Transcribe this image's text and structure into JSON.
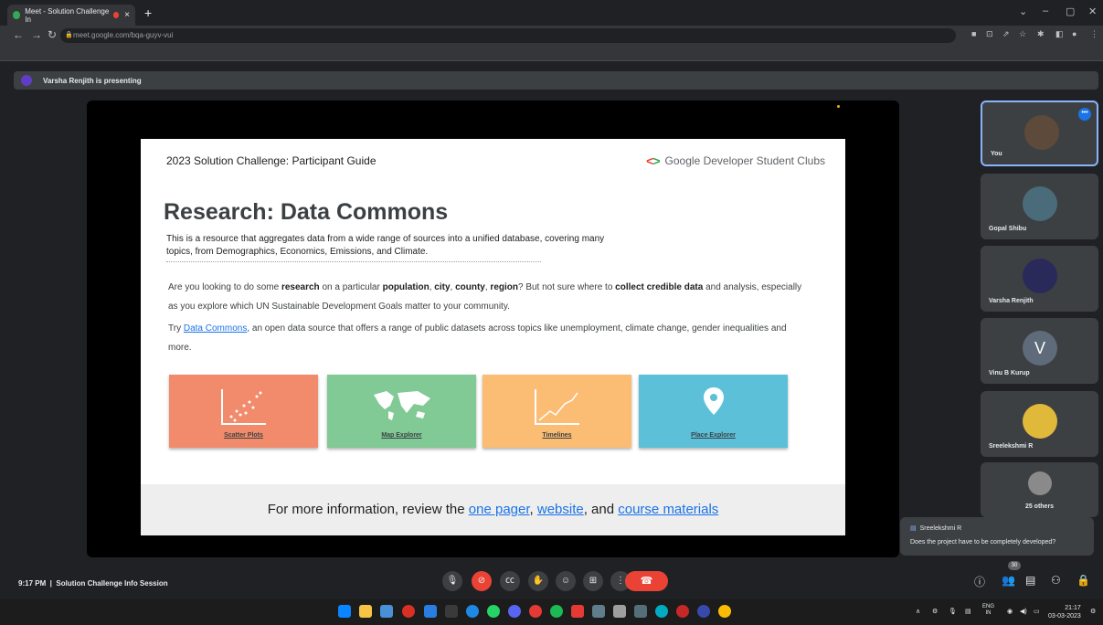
{
  "browser": {
    "tab_title": "Meet - Solution Challenge In",
    "url": "meet.google.com/bqa-guyv-vui"
  },
  "meet": {
    "presenting_text": "Varsha Renjith is presenting",
    "slide": {
      "header": "2023 Solution Challenge: Participant Guide",
      "brand": "Google Developer Student Clubs",
      "title": "Research: Data Commons",
      "subtitle": "This is a resource that aggregates data from a wide range of sources into a unified database, covering many topics, from Demographics, Economics, Emissions, and Climate.",
      "p1": {
        "t1": "Are you looking to do some ",
        "b1": "research",
        "t2": " on a particular ",
        "b2": "population",
        "t3": ", ",
        "b3": "city",
        "t4": ", ",
        "b4": "county",
        "t5": ", ",
        "b5": "region",
        "t6": "? But not sure where to ",
        "b6": "collect credible data",
        "t7": " and analysis, especially as you explore which UN Sustainable Development Goals matter to your community."
      },
      "p2": {
        "t1": "Try ",
        "link": "Data Commons",
        "t2": ", an open data source that offers a range of public datasets across topics like unemployment, climate change, gender inequalities and more."
      },
      "cards": [
        {
          "label": "Scatter Plots",
          "color": "#f28b6c"
        },
        {
          "label": "Map Explorer",
          "color": "#81c995"
        },
        {
          "label": "Timelines",
          "color": "#fbbc74"
        },
        {
          "label": "Place Explorer",
          "color": "#5bc0d8"
        }
      ],
      "footer": {
        "t1": "For more information, review the ",
        "l1": "one pager",
        "t2": ", ",
        "l2": "website",
        "t3": ", and ",
        "l3": "course materials"
      }
    },
    "participants": [
      {
        "name": "You"
      },
      {
        "name": "Gopal Shibu"
      },
      {
        "name": "Varsha Renjith"
      },
      {
        "name": "Vinu B Kurup",
        "initial": "V"
      },
      {
        "name": "Sreelekshmi R"
      },
      {
        "name": "25 others"
      }
    ],
    "chat_popup": {
      "sender": "Sreelekshmi R",
      "message": "Does the project have to be completely developed?"
    },
    "bottom": {
      "time": "9:17 PM",
      "meeting_name": "Solution Challenge Info Session",
      "people_count": "30"
    }
  },
  "taskbar": {
    "lang": "ENG",
    "region": "IN",
    "clock_time": "21:17",
    "clock_date": "03-03-2023"
  }
}
